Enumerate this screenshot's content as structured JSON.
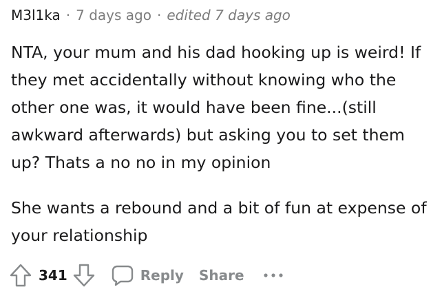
{
  "comment": {
    "author": "M3l1ka",
    "separator": "·",
    "time": "7 days ago",
    "edited": "edited 7 days ago",
    "paragraphs": [
      "NTA, your mum and his dad hooking up is weird! If they met accidentally without knowing who the other one was, it would have been fine...(still awkward afterwards) but asking you to set them up? Thats a no no in my opinion",
      "She wants a rebound and a bit of fun at expense of your relationship"
    ]
  },
  "actions": {
    "upvote_icon": "arrow-up-icon",
    "score": "341",
    "downvote_icon": "arrow-down-icon",
    "reply_icon": "speech-bubble-icon",
    "reply_label": "Reply",
    "share_label": "Share",
    "more_icon": "ellipsis-icon",
    "icon_color": "#878a8c"
  }
}
